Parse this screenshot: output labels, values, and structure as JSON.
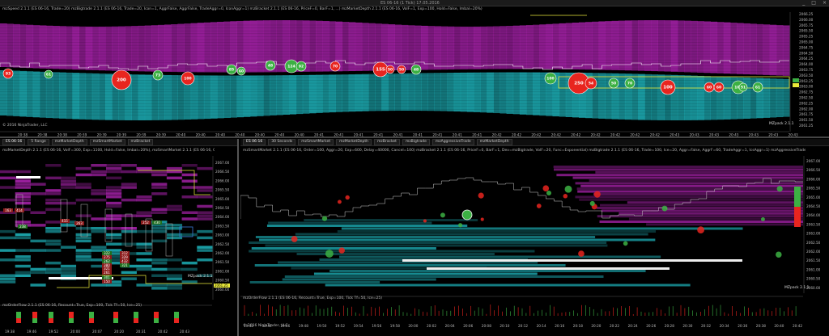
{
  "window": {
    "title": "ES 06-16 (1 Tick)  17.05.2016",
    "controls": [
      "_",
      "□",
      "×"
    ]
  },
  "top_chart": {
    "header": "mzSpeed 2.1.1 (ES 06-16, Trade=20)  mzBigtrade 2.1.1 (ES 06-16, Trade=20, Icon=1, AggrFalse, AggrFalse, TradeAggr=0, IconAggr=1)  mzBracket 2.1.1 (ES 06-16, PriceF=0, BarF=1, ...)  mzMarketDepth 2.1.1 (ES 06-16, VolF=1, Exp=100, Hold=False, Imbal=20%)",
    "price_labels": [
      "2066.25",
      "2066.00",
      "2065.75",
      "2065.50",
      "2065.25",
      "2065.00",
      "2064.75",
      "2064.50",
      "2064.25",
      "2064.00",
      "2063.75",
      "2063.50",
      "2063.25",
      "2063.00",
      "2062.75",
      "2062.50",
      "2062.25",
      "2062.00",
      "2061.75",
      "2061.50",
      "2061.25"
    ],
    "time_labels": [
      "20:38",
      "20:38",
      "20:38",
      "20:39",
      "20:39",
      "20:39",
      "20:39",
      "20:39",
      "20:40",
      "20:40",
      "20:40",
      "20:40",
      "20:40",
      "20:40",
      "20:40",
      "20:41",
      "20:41",
      "20:41",
      "20:41",
      "20:41",
      "20:41",
      "20:41",
      "20:41",
      "20:41",
      "20:42",
      "20:42",
      "20:42",
      "20:42",
      "20:42",
      "20:42",
      "20:42",
      "20:42",
      "20:42",
      "20:43",
      "20:43",
      "20:43",
      "20:43",
      "20:43",
      "20:43",
      "20:43"
    ],
    "trade_bubbles": [
      {
        "label": "93",
        "color": "red"
      },
      {
        "label": "61",
        "color": "green"
      },
      {
        "label": "200",
        "color": "red"
      },
      {
        "label": "73",
        "color": "green"
      },
      {
        "label": "100",
        "color": "red"
      },
      {
        "label": "85",
        "color": "green"
      },
      {
        "label": "60",
        "color": "green"
      },
      {
        "label": "48",
        "color": "green"
      },
      {
        "label": "124",
        "color": "green"
      },
      {
        "label": "92",
        "color": "green"
      },
      {
        "label": "70",
        "color": "red"
      },
      {
        "label": "155",
        "color": "red"
      },
      {
        "label": "50",
        "color": "red"
      },
      {
        "label": "50",
        "color": "red"
      },
      {
        "label": "48",
        "color": "green"
      },
      {
        "label": "100",
        "color": "green"
      },
      {
        "label": "250",
        "color": "red"
      },
      {
        "label": "54",
        "color": "red"
      },
      {
        "label": "50",
        "color": "green"
      },
      {
        "label": "70",
        "color": "green"
      },
      {
        "label": "100",
        "color": "red"
      },
      {
        "label": "60",
        "color": "red"
      },
      {
        "label": "60",
        "color": "red"
      },
      {
        "label": "100",
        "color": "green"
      },
      {
        "label": "51",
        "color": "green"
      },
      {
        "label": "61",
        "color": "green"
      }
    ],
    "copyright": "© 2016 NinjaTrader, LLC",
    "watermark": "MZpack 2.1.1"
  },
  "left_panel": {
    "tabs": [
      "ES 06-16",
      "5 Range",
      "mzMarketDepth",
      "mzSmartMarket",
      "mzBracket"
    ],
    "header": "mzMarketDepth 2.1.1 (ES 06-16, VolF=300, Exp=1100, Hold=False, Imbal=20%), mzSmartMarket 2.1.1 (ES 06-16, Order=50, Aggr)",
    "price_labels": [
      "2067.00",
      "2066.50",
      "2066.00",
      "2065.50",
      "2065.00",
      "2064.50",
      "2064.00",
      "2063.50",
      "2063.00",
      "2062.50",
      "2062.00",
      "2061.50",
      "2061.00",
      "2060.50",
      "2060.00"
    ],
    "volume_labels": [
      "163",
      "414",
      "238",
      "415",
      "263",
      "322",
      "312",
      "252",
      "430",
      "275",
      "329",
      "262",
      "432",
      "380",
      "321",
      "321",
      "261",
      "301",
      "150"
    ],
    "last_price": "2061.25",
    "watermark": "MZpack 2.1.1",
    "orderflow_header": "mzOrderFlow 2.1.1 (ES 06-16, Recount=True, Exp=100, Tick Tf=50, Ice=25)",
    "time_labels": [
      "19:38",
      "19:46",
      "19:52",
      "20:00",
      "20:07",
      "20:20",
      "20:31",
      "20:42",
      "20:43"
    ],
    "copyright": "© 2016 NinjaTrader, LLC"
  },
  "right_panel": {
    "tabs": [
      "ES 06-16",
      "30 Seconds",
      "mzSmartMarket",
      "mzMarketDepth",
      "mzBracket",
      "mzBigtrade",
      "mzAggressiveTrade",
      "mzMarketDepth"
    ],
    "header": "mzSmartMarket 2.1.1 (ES 06-16, Order=100, Aggr=20, Exp=600, Delay=40000, Cancel=100)  mzBracket 2.1.1 (ES 06-16, PriceF=0, BarF=1, Dev=mzBigtrade, VolF=20, Func=Exponential)  mzBigtrade 2.1.1 (ES 06-16, Trade=100, Ice=20, Aggr=False, AggrF=60, TradeAggr=1, IcsAggr=1)  mzAggressiveTrade 2.1.1 (ES 06-16, VolF=60, Aggr=1, Exp=100, Calib=40)",
    "price_labels": [
      "2067.00",
      "2066.50",
      "2066.00",
      "2065.50",
      "2065.00",
      "2064.50",
      "2064.00",
      "2063.50",
      "2063.00",
      "2062.50",
      "2062.00",
      "2061.50",
      "2061.00",
      "2060.50",
      "2060.00"
    ],
    "watermark": "MZpack 2.1.1",
    "orderflow_header": "mzOrderFlow 2.1.1 (ES 06-16, Recount=True, Exp=100, Tick Tf=50, Ice=25)",
    "time_labels": [
      "19:42",
      "19:44",
      "19:46",
      "19:48",
      "19:50",
      "19:52",
      "19:54",
      "19:56",
      "19:58",
      "20:00",
      "20:02",
      "20:04",
      "20:06",
      "20:08",
      "20:10",
      "20:12",
      "20:14",
      "20:16",
      "20:18",
      "20:20",
      "20:22",
      "20:24",
      "20:26",
      "20:28",
      "20:30",
      "20:32",
      "20:34",
      "20:36",
      "20:38",
      "20:40",
      "20:42"
    ],
    "copyright": "© 2016 NinjaTrader, LLC"
  },
  "colors": {
    "ask": "#9b1f9e",
    "bid": "#1a9fa6",
    "buy": "#3cb043",
    "sell": "#e8251f",
    "highlight": "#e8e83a"
  }
}
